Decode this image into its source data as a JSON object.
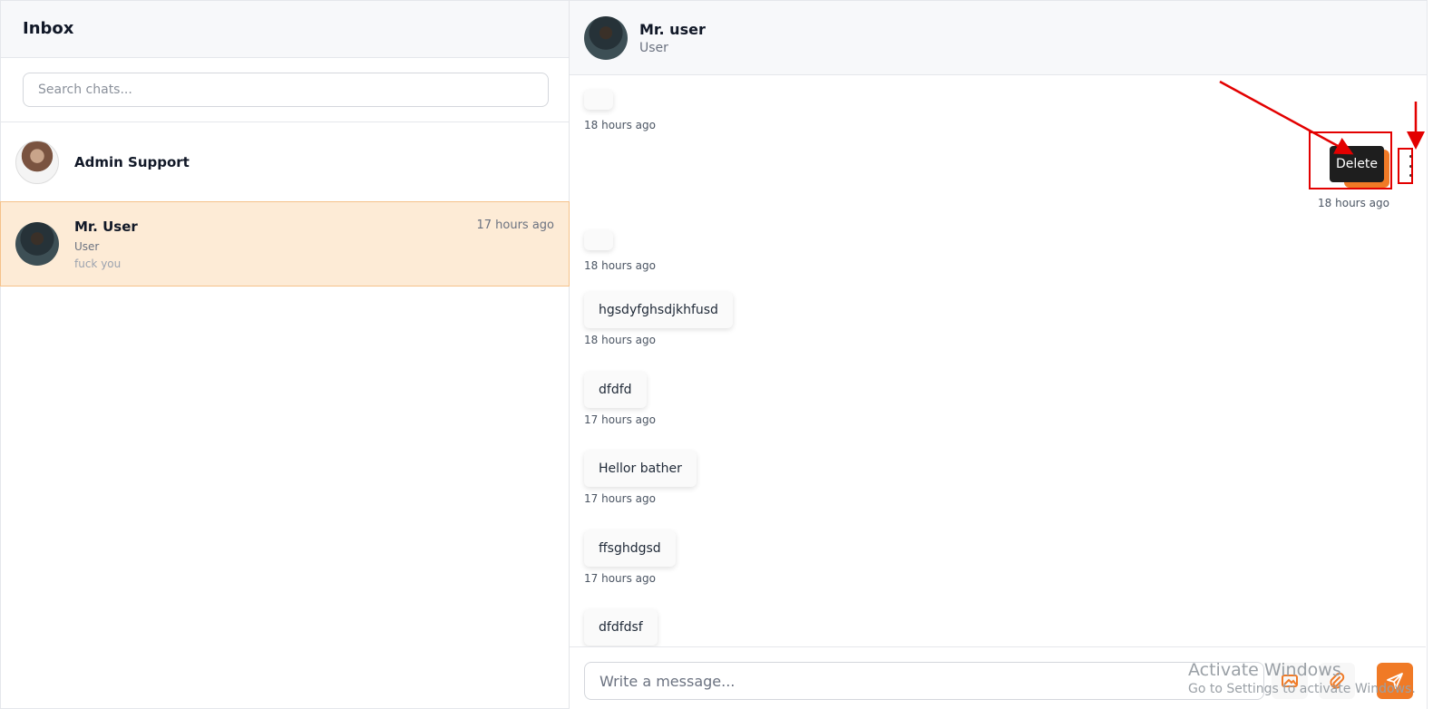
{
  "sidebar": {
    "title": "Inbox",
    "search_placeholder": "Search chats...",
    "chats": [
      {
        "name": "Admin Support",
        "avatar_icon": "admin-avatar"
      },
      {
        "name": "Mr. User",
        "role": "User",
        "last_message": "fuck you",
        "time": "17 hours ago",
        "active": true,
        "avatar_icon": "user-avatar"
      }
    ]
  },
  "conversation": {
    "name": "Mr. user",
    "role": "User",
    "messages": [
      {
        "direction": "received",
        "text": "",
        "time": "18 hours ago"
      },
      {
        "direction": "sent",
        "text": "",
        "time": "18 hours ago"
      },
      {
        "direction": "received",
        "text": "",
        "time": "18 hours ago"
      },
      {
        "direction": "received",
        "text": "hgsdyfghsdjkhfusd",
        "time": "18 hours ago"
      },
      {
        "direction": "received",
        "text": "dfdfd",
        "time": "17 hours ago"
      },
      {
        "direction": "received",
        "text": "Hellor bather",
        "time": "17 hours ago"
      },
      {
        "direction": "received",
        "text": "ffsghdgsd",
        "time": "17 hours ago"
      },
      {
        "direction": "received",
        "text": "dfdfdsf",
        "time": ""
      }
    ],
    "context_menu": {
      "delete_label": "Delete"
    }
  },
  "composer": {
    "placeholder": "Write a message..."
  },
  "watermark": {
    "line1": "Activate Windows",
    "line2": "Go to Settings to activate Windows."
  },
  "colors": {
    "accent": "#f07a26",
    "active_row": "#fdebd6",
    "annotation": "#e30000"
  }
}
